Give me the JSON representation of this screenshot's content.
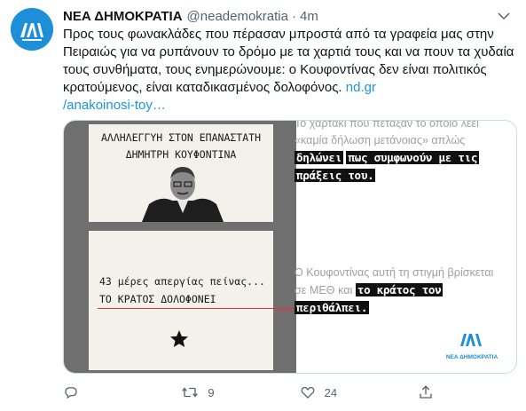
{
  "tweet": {
    "display_name": "ΝΕΑ ΔΗΜΟΚΡΑΤΙΑ",
    "handle": "@neademokratia",
    "separator": "·",
    "time": "4m",
    "text": "Προς τους φωνακλάδες που πέρασαν μπροστά από τα γραφεία μας στην Πειραιώς για να ρυπάνουν το δρόμο με τα χαρτιά τους και να πουν τα χυδαία τους συνθήματα, τους ενημερώνουμε: ο Κουφοντίνας δεν είναι πολιτικός κρατούμενος, είναι καταδικασμένος δολοφόνος.",
    "link_text": "nd.gr/anakoinosi-toy…",
    "link_text_part1": "nd.gr",
    "link_text_part2": "/anakoinosi-toy…"
  },
  "media": {
    "card1_line1": "ΑΛΛΗΛΕΓΓΥΗ ΣΤΟΝ ΕΠΑΝΑΣΤΑΤΗ",
    "card1_line2": "ΔΗΜΗΤΡΗ ΚΟΥΦΟΝΤΙΝΑ",
    "card2_line1": "43 μέρες απεργίας πείνας...",
    "card2_line2": "ΤΟ ΚΡΑΤΟΣ ΔΟΛΟΦΟΝΕΙ",
    "right_top_grey": "Το χαρτάκι που πέταξαν το οποίο λέει «καμία δήλωση μετάνοιας» απλώς",
    "right_top_highlight_1": "δηλώνει",
    "right_top_highlight_2": "πως συμφωνούν με τις",
    "right_top_highlight_3": "πράξεις του.",
    "right_bottom_grey": "Ο Κουφοντίνας αυτή τη στιγμή βρίσκεται σε ΜΕΘ και",
    "right_bottom_highlight_1": "το κράτος τον",
    "right_bottom_highlight_2": "περιθάλπει.",
    "brand_name": "ΝΕΑ ΔΗΜΟΚΡΑΤΙΑ",
    "brand_color": "#1d8fd9"
  },
  "actions": {
    "reply_icon": "reply-icon",
    "reply_count": "",
    "retweet_icon": "retweet-icon",
    "retweet_count": "9",
    "like_icon": "heart-icon",
    "like_count": "24",
    "share_icon": "share-icon"
  },
  "colors": {
    "link": "#1b95e0",
    "secondary_text": "#536471",
    "accent_blue": "#1d8fd9"
  }
}
